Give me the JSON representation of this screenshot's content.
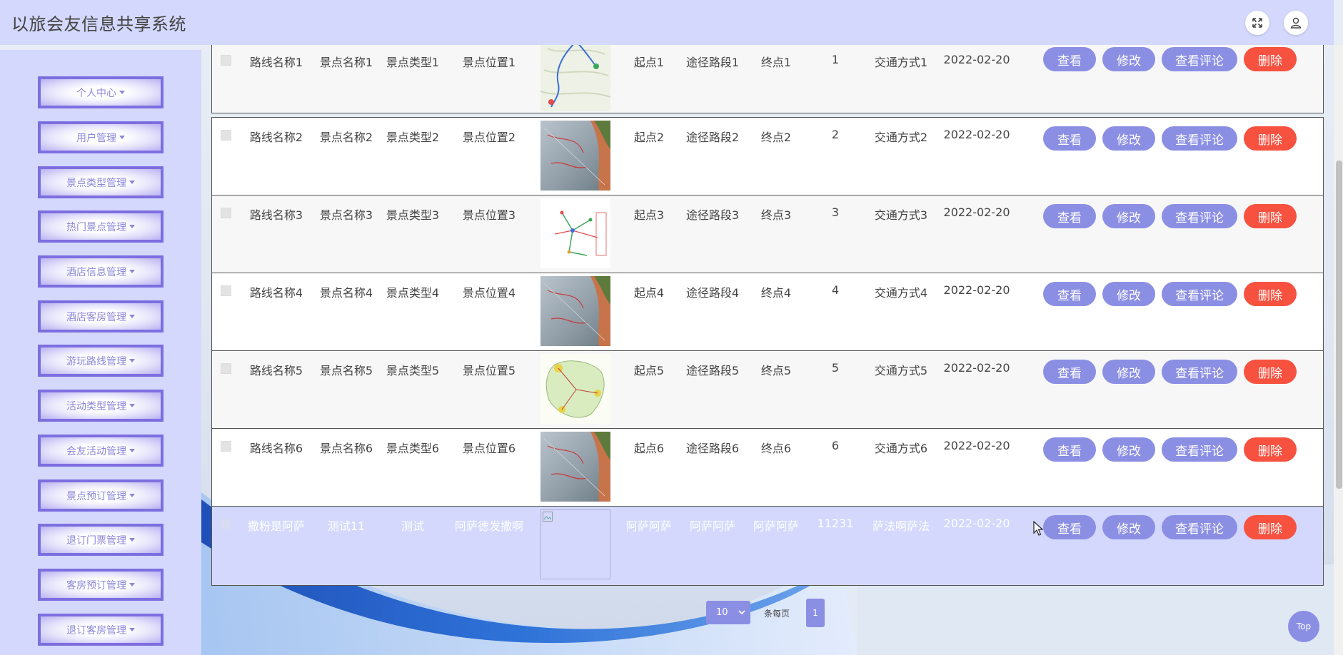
{
  "app": {
    "title": "以旅会友信息共享系统"
  },
  "header": {
    "fullscreen_icon": "expand-icon",
    "user_icon": "user-icon"
  },
  "sidebar": {
    "items": [
      {
        "label": "个人中心"
      },
      {
        "label": "用户管理"
      },
      {
        "label": "景点类型管理"
      },
      {
        "label": "热门景点管理"
      },
      {
        "label": "酒店信息管理"
      },
      {
        "label": "酒店客房管理"
      },
      {
        "label": "游玩路线管理"
      },
      {
        "label": "活动类型管理"
      },
      {
        "label": "会友活动管理"
      },
      {
        "label": "景点预订管理"
      },
      {
        "label": "退订门票管理"
      },
      {
        "label": "客房预订管理"
      },
      {
        "label": "退订客房管理"
      }
    ]
  },
  "table": {
    "buttons": {
      "view": "查看",
      "edit": "修改",
      "comment": "查看评论",
      "delete": "删除"
    },
    "rows": [
      {
        "route": "路线名称1",
        "spot": "景点名称1",
        "type": "景点类型1",
        "location": "景点位置1",
        "image": "map-thumbnail",
        "start": "起点1",
        "via": "途径路段1",
        "end": "终点1",
        "num": "1",
        "transport": "交通方式1",
        "date": "2022-02-20"
      },
      {
        "route": "路线名称2",
        "spot": "景点名称2",
        "type": "景点类型2",
        "location": "景点位置2",
        "image": "map-thumbnail",
        "start": "起点2",
        "via": "途径路段2",
        "end": "终点2",
        "num": "2",
        "transport": "交通方式2",
        "date": "2022-02-20"
      },
      {
        "route": "路线名称3",
        "spot": "景点名称3",
        "type": "景点类型3",
        "location": "景点位置3",
        "image": "map-thumbnail",
        "start": "起点3",
        "via": "途径路段3",
        "end": "终点3",
        "num": "3",
        "transport": "交通方式3",
        "date": "2022-02-20"
      },
      {
        "route": "路线名称4",
        "spot": "景点名称4",
        "type": "景点类型4",
        "location": "景点位置4",
        "image": "map-thumbnail",
        "start": "起点4",
        "via": "途径路段4",
        "end": "终点4",
        "num": "4",
        "transport": "交通方式4",
        "date": "2022-02-20"
      },
      {
        "route": "路线名称5",
        "spot": "景点名称5",
        "type": "景点类型5",
        "location": "景点位置5",
        "image": "map-thumbnail",
        "start": "起点5",
        "via": "途径路段5",
        "end": "终点5",
        "num": "5",
        "transport": "交通方式5",
        "date": "2022-02-20"
      },
      {
        "route": "路线名称6",
        "spot": "景点名称6",
        "type": "景点类型6",
        "location": "景点位置6",
        "image": "map-thumbnail",
        "start": "起点6",
        "via": "途径路段6",
        "end": "终点6",
        "num": "6",
        "transport": "交通方式6",
        "date": "2022-02-20"
      },
      {
        "route": "撒粉是阿萨",
        "spot": "测试11",
        "type": "测试",
        "location": "阿萨德发撒啊",
        "image": "broken-image",
        "start": "阿萨阿萨",
        "via": "阿萨阿萨",
        "end": "阿萨阿萨",
        "num": "11231",
        "transport": "萨法啊萨法",
        "date": "2022-02-20"
      }
    ]
  },
  "pagination": {
    "page_size": "10",
    "per_page_label": "条每页",
    "current_page": "1"
  },
  "top_button": {
    "label": "Top"
  },
  "colors": {
    "accent": "#8b8fe4",
    "danger": "#f7513f",
    "header_bg": "#d3d8fc",
    "menu_border": "#7d6ee0"
  }
}
